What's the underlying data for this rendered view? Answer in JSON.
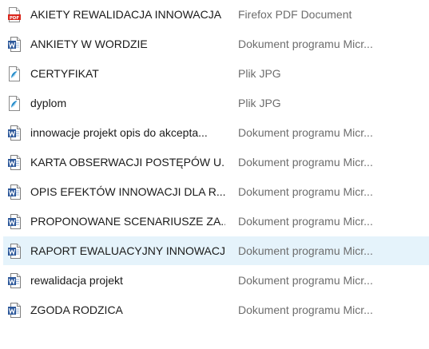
{
  "files": [
    {
      "name": "AKIETY REWALIDACJA INNOWACJA",
      "type": "Firefox PDF Document",
      "icon": "pdf-file-icon",
      "selected": false
    },
    {
      "name": "ANKIETY W WORDZIE",
      "type": "Dokument programu Micr...",
      "icon": "word-document-icon",
      "selected": false
    },
    {
      "name": "CERTYFIKAT",
      "type": "Plik JPG",
      "icon": "jpg-image-icon",
      "selected": false
    },
    {
      "name": "dyplom",
      "type": "Plik JPG",
      "icon": "jpg-image-icon",
      "selected": false
    },
    {
      "name": "innowacje projekt opis do akcepta...",
      "type": "Dokument programu Micr...",
      "icon": "word-document-icon",
      "selected": false
    },
    {
      "name": "KARTA OBSERWACJI POSTĘPÓW U...",
      "type": "Dokument programu Micr...",
      "icon": "word-document-icon",
      "selected": false
    },
    {
      "name": "OPIS EFEKTÓW INNOWACJI DLA R...",
      "type": "Dokument programu Micr...",
      "icon": "word-document-icon",
      "selected": false
    },
    {
      "name": "PROPONOWANE SCENARIUSZE ZA...",
      "type": "Dokument programu Micr...",
      "icon": "word-document-icon",
      "selected": false
    },
    {
      "name": "RAPORT EWALUACYJNY INNOWACJI",
      "type": "Dokument programu Micr...",
      "icon": "word-document-icon",
      "selected": true
    },
    {
      "name": "rewalidacja projekt",
      "type": "Dokument programu Micr...",
      "icon": "word-document-icon",
      "selected": false
    },
    {
      "name": "ZGODA RODZICA",
      "type": "Dokument programu Micr...",
      "icon": "word-document-icon",
      "selected": false
    }
  ],
  "colors": {
    "selected_row_bg": "#e5f3fb",
    "word_blue": "#2b579a",
    "pdf_red": "#d9261c",
    "jpg_blue": "#1e88c8"
  }
}
